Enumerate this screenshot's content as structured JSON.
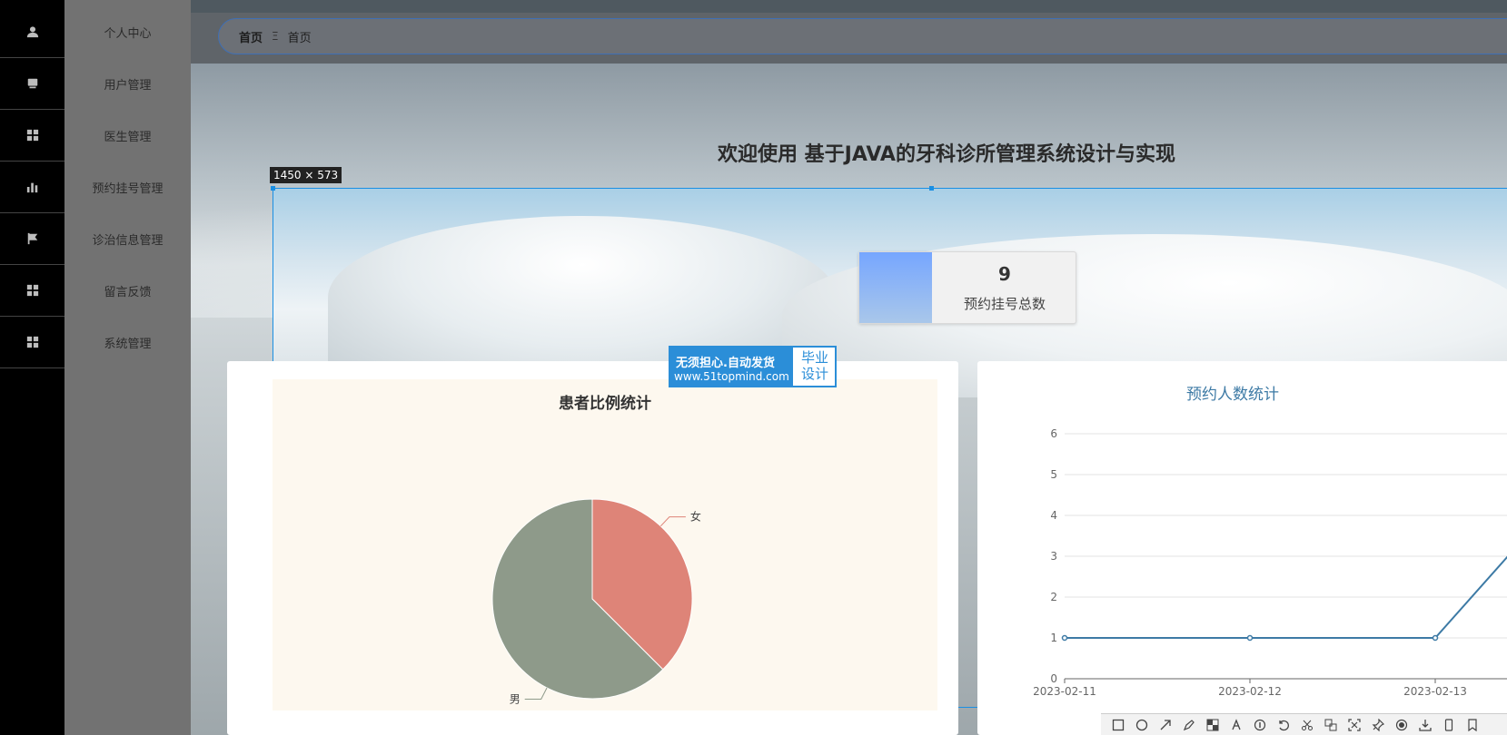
{
  "sidebar": {
    "items": [
      {
        "label": "个人中心",
        "icon": "person-icon"
      },
      {
        "label": "用户管理",
        "icon": "card-icon"
      },
      {
        "label": "医生管理",
        "icon": "grid-icon"
      },
      {
        "label": "预约挂号管理",
        "icon": "bar-chart-icon"
      },
      {
        "label": "诊治信息管理",
        "icon": "flag-icon"
      },
      {
        "label": "留言反馈",
        "icon": "grid-icon"
      },
      {
        "label": "系统管理",
        "icon": "grid-icon"
      }
    ]
  },
  "breadcrumb": {
    "home": "首页",
    "separator": "Ξ",
    "current": "首页"
  },
  "welcome": "欢迎使用 基于JAVA的牙科诊所管理系统设计与实现",
  "selection_label": "1450 × 573",
  "stat": {
    "value": "9",
    "label": "预约挂号总数"
  },
  "watermark": {
    "line1": "无须担心.自动发货",
    "line2": "www.51topmind.com",
    "right1": "毕业",
    "right2": "设计"
  },
  "colors": {
    "accent": "#1a8fe3",
    "female": "#de8478",
    "male": "#8e9a8a",
    "line": "#3d7aa5"
  },
  "chart_data": [
    {
      "type": "pie",
      "title": "患者比例统计",
      "slices": [
        {
          "name": "女",
          "value": 3
        },
        {
          "name": "男",
          "value": 5
        }
      ]
    },
    {
      "type": "line",
      "title": "预约人数统计",
      "x": [
        "2023-02-11",
        "2023-02-12",
        "2023-02-13"
      ],
      "series": [
        {
          "values": [
            1,
            1,
            1
          ]
        }
      ],
      "ylim": [
        0,
        6
      ],
      "yticks": [
        0,
        1,
        2,
        3,
        4,
        5,
        6
      ],
      "grid": true
    }
  ]
}
